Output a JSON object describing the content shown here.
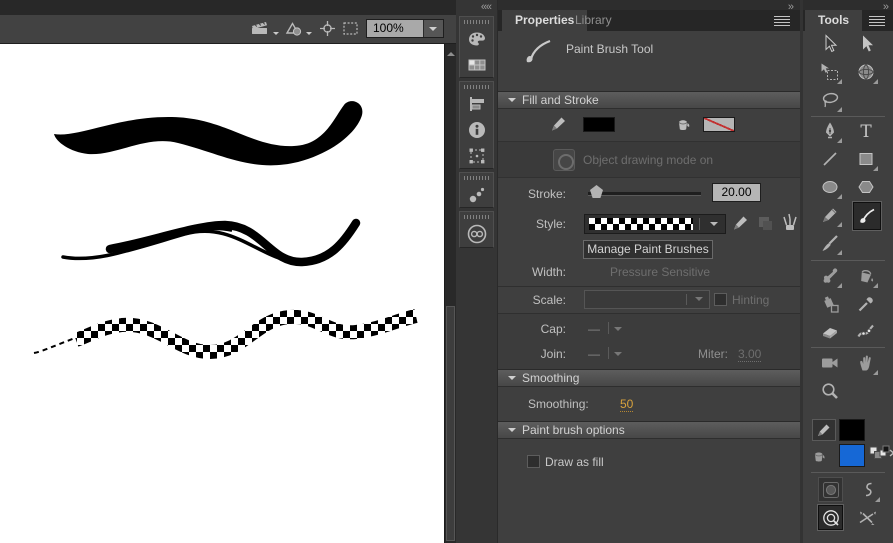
{
  "colors": {
    "canvas_stroke": "#000000",
    "tools_fill_color": "#1668d6",
    "tools_stroke_color": "#000000",
    "hot_text": "#d7a23d",
    "no_fill_red": "#cc3333"
  },
  "stage": {
    "toolbar": {
      "zoom_value": "100%",
      "icons": [
        "clapperboard-icon",
        "shape-primitives-icon",
        "center-stage-icon",
        "clip-outline-icon"
      ]
    },
    "canvas_strokes": [
      "smooth-tapered-brush-stroke",
      "rough-brush-stroke",
      "checkered-style-brush-stroke"
    ]
  },
  "dock": {
    "collapse_chevrons": "«",
    "icons": [
      "color-palette-icon",
      "swatches-icon",
      "align-icon",
      "info-icon",
      "transform-icon",
      "history-icon",
      "creative-cloud-icon"
    ]
  },
  "properties": {
    "expand_chevrons": "»",
    "tabs": [
      {
        "label": "Properties",
        "active": true
      },
      {
        "label": "Library",
        "active": false
      }
    ],
    "tool_title": "Paint Brush Tool",
    "fill_stroke": {
      "header": "Fill and Stroke",
      "object_drawing_label": "Object drawing mode on",
      "stroke_label": "Stroke:",
      "stroke_value": "20.00",
      "style_label": "Style:",
      "style_value": "checkered-brush-pattern",
      "manage_brushes_button": "Manage Paint Brushes",
      "width_label": "Width:",
      "width_value": "Pressure Sensitive",
      "scale_label": "Scale:",
      "hinting_label": "Hinting",
      "hinting_checked": false,
      "cap_label": "Cap:",
      "join_label": "Join:",
      "miter_label": "Miter:",
      "miter_value": "3.00"
    },
    "smoothing": {
      "header": "Smoothing",
      "label": "Smoothing:",
      "value": "50"
    },
    "paint_brush_options": {
      "header": "Paint brush options",
      "draw_as_fill_label": "Draw as fill",
      "draw_as_fill_checked": false
    }
  },
  "tools": {
    "expand_chevrons": "»",
    "tab_label": "Tools",
    "selected_tool": "paint-brush",
    "text_tool_glyph": "T",
    "tool_names": [
      "selection",
      "subselection",
      "free-transform",
      "3d-rotation",
      "lasso",
      "pen",
      "text",
      "line",
      "rectangle",
      "oval",
      "polystar",
      "pencil",
      "paint-brush",
      "classic-brush",
      "bone",
      "paint-bucket",
      "ink-bottle",
      "eyedropper",
      "eraser",
      "width-tool",
      "camera",
      "hand",
      "zoom",
      "object-drawing-mode",
      "curve-options",
      "brush-mode",
      "use-pressure"
    ]
  }
}
